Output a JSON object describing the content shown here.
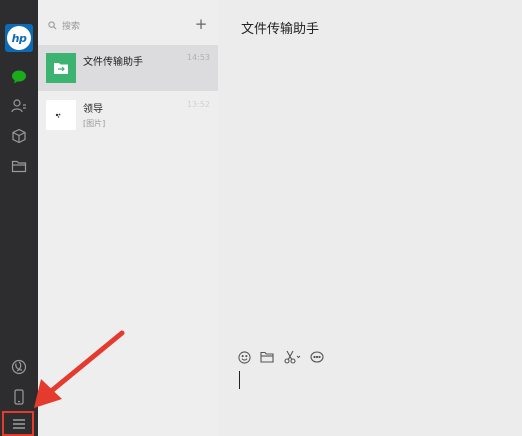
{
  "sidebar": {
    "avatar_text": "hp",
    "icons": [
      "chat-icon",
      "contacts-icon",
      "favorites-icon",
      "files-icon",
      "moments-icon",
      "phone-icon",
      "menu-icon"
    ],
    "active_color": "#1aad19",
    "highlight_color": "#e53a2e"
  },
  "search": {
    "placeholder": "搜索",
    "add_label": "+"
  },
  "chats": [
    {
      "name": "文件传输助手",
      "time": "14:53",
      "preview": "",
      "avatar": "file-transfer-icon",
      "active": true
    },
    {
      "name": "领导",
      "time": "13:52",
      "preview": "[图片]",
      "avatar": "contact-avatar",
      "active": false
    }
  ],
  "main": {
    "title": "文件传输助手",
    "toolbar": [
      "emoji-icon",
      "folder-icon",
      "scissors-icon",
      "chat-bubble-icon"
    ]
  },
  "colors": {
    "sidebar_bg": "#2d2d2f",
    "list_bg": "#eeeeee",
    "active_item_bg": "#dcdcdf",
    "file_transfer_green": "#3cb371",
    "annotation_red": "#e53a2e"
  }
}
